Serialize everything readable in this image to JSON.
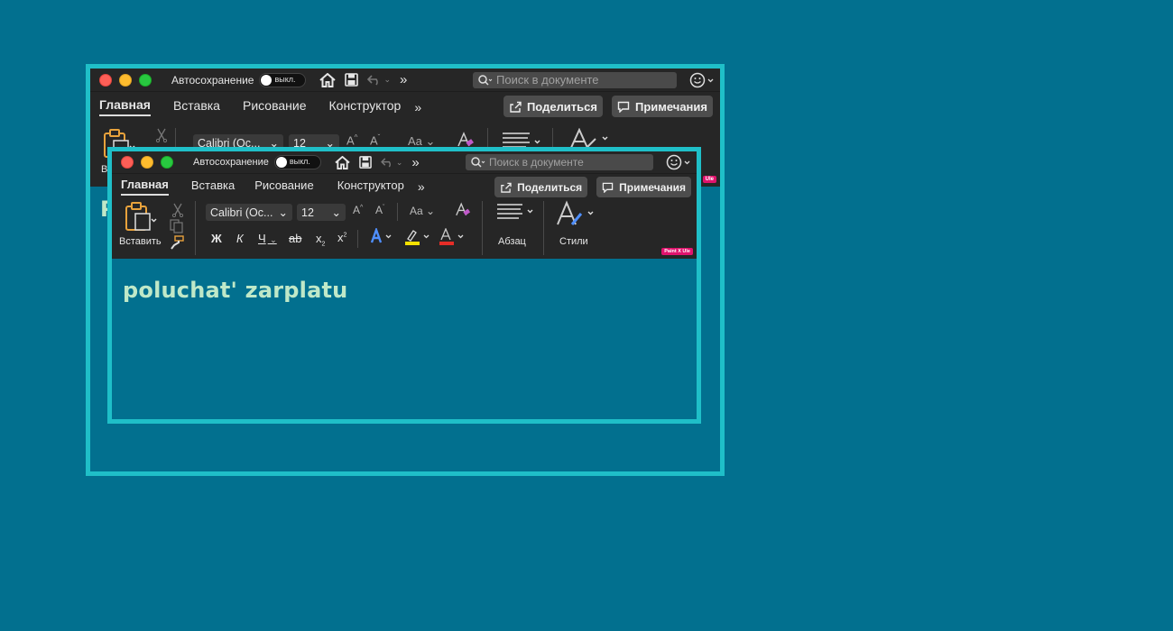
{
  "windows": [
    {
      "id": "back",
      "autosave_label": "Автосохранение",
      "autosave_state": "выкл.",
      "search_placeholder": "Поиск в документе",
      "tabs": [
        "Главная",
        "Вставка",
        "Рисование",
        "Конструктор"
      ],
      "share_label": "Поделиться",
      "comments_label": "Примечания",
      "font_name": "Calibri (Ос...",
      "font_size": "12",
      "paste_label_partial": "Во",
      "doc_peek": "P",
      "badge": "Ule"
    },
    {
      "id": "front",
      "autosave_label": "Автосохранение",
      "autosave_state": "выкл.",
      "search_placeholder": "Поиск в документе",
      "tabs": [
        "Главная",
        "Вставка",
        "Рисование",
        "Конструктор"
      ],
      "share_label": "Поделиться",
      "comments_label": "Примечания",
      "font_name": "Calibri (Ос...",
      "font_size": "12",
      "paste_label": "Вставить",
      "paragraph_label": "Абзац",
      "styles_label": "Стили",
      "bold": "Ж",
      "italic": "К",
      "underline": "Ч",
      "strike": "ab",
      "subscript": "x",
      "superscript": "x",
      "sub_mark": "2",
      "sup_mark": "2",
      "case_btn": "Aa",
      "grow": "A",
      "shrink": "A",
      "badge": "Paint X Ule",
      "doc_text": "poluchat'  zarplatu"
    }
  ],
  "colors": {
    "background": "#02708f",
    "frame": "#1fbfc8",
    "toolbar": "#262626",
    "doc_text": "#bfe8c8",
    "highlight": "#f5e100",
    "font_color": "#e52d27",
    "badge": "#e0136d"
  },
  "icons": [
    "home-icon",
    "save-icon",
    "undo-icon",
    "more-icon",
    "search-icon",
    "smiley-icon",
    "share-icon",
    "comment-icon",
    "paste-icon",
    "cut-icon",
    "copy-icon",
    "format-painter-icon",
    "clear-format-icon",
    "text-effects-icon",
    "highlight-icon",
    "font-color-icon",
    "paragraph-icon",
    "styles-icon"
  ]
}
